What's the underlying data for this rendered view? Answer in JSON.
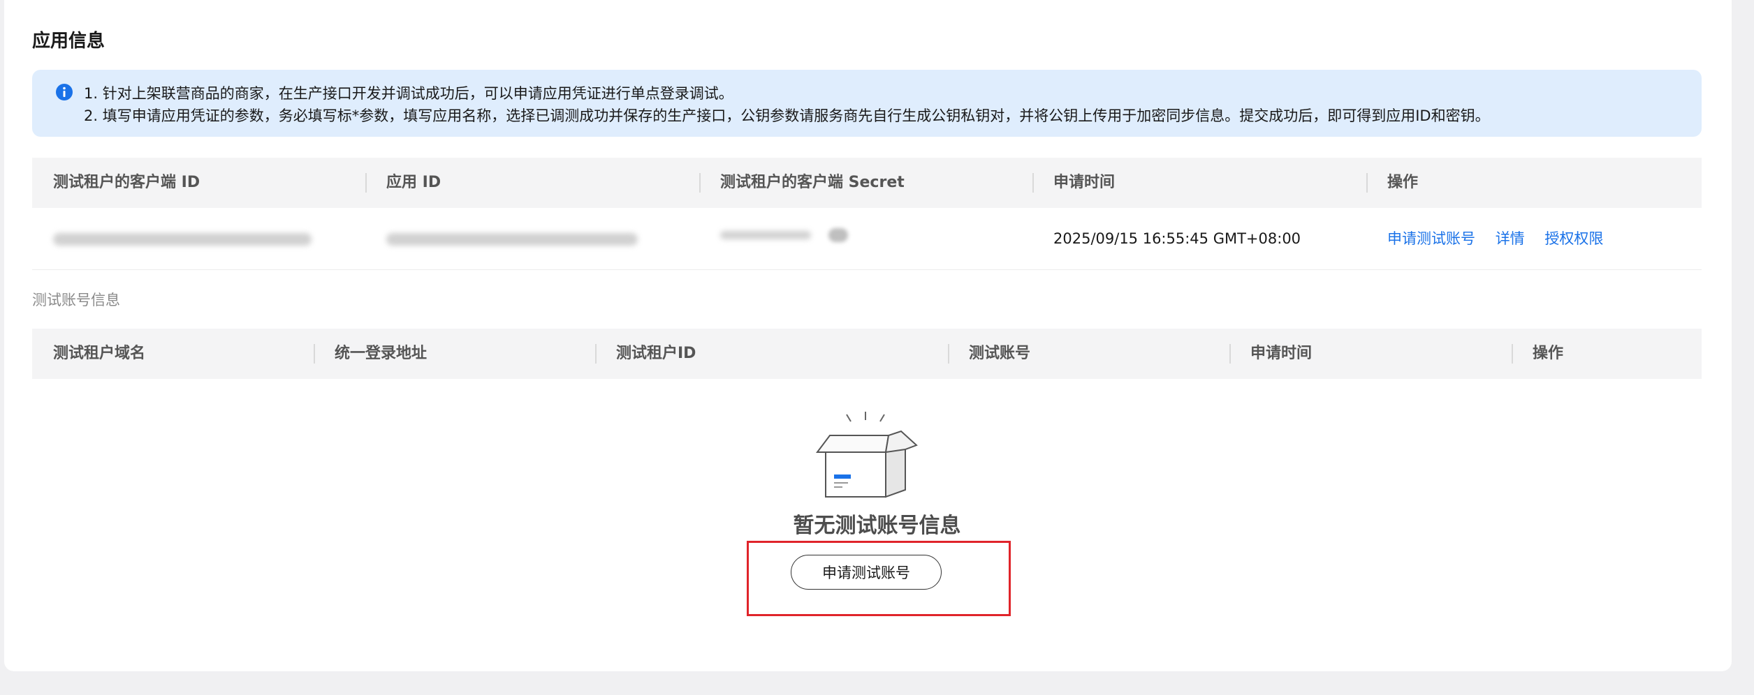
{
  "section_title": "应用信息",
  "notice": {
    "icon": "info-icon",
    "line1": "1. 针对上架联营商品的商家，在生产接口开发并调试成功后，可以申请应用凭证进行单点登录调试。",
    "line2": "2. 填写申请应用凭证的参数，务必填写标*参数，填写应用名称，选择已调测成功并保存的生产接口，公钥参数请服务商先自行生成公钥私钥对，并将公钥上传用于加密同步信息。提交成功后，即可得到应用ID和密钥。"
  },
  "app_table": {
    "headers": [
      "测试租户的客户端 ID",
      "应用 ID",
      "测试租户的客户端 Secret",
      "申请时间",
      "操作"
    ],
    "rows": [
      {
        "apply_time": "2025/09/15 16:55:45 GMT+08:00",
        "actions": [
          "申请测试账号",
          "详情",
          "授权权限"
        ]
      }
    ]
  },
  "test_account_title": "测试账号信息",
  "account_table": {
    "headers": [
      "测试租户域名",
      "统一登录地址",
      "测试租户ID",
      "测试账号",
      "申请时间",
      "操作"
    ]
  },
  "empty_state": {
    "icon": "empty-box-icon",
    "text": "暂无测试账号信息",
    "button": "申请测试账号"
  },
  "colors": {
    "accent": "#1a72e8",
    "notice_bg": "#dfedfd",
    "highlight": "#e0242a"
  }
}
